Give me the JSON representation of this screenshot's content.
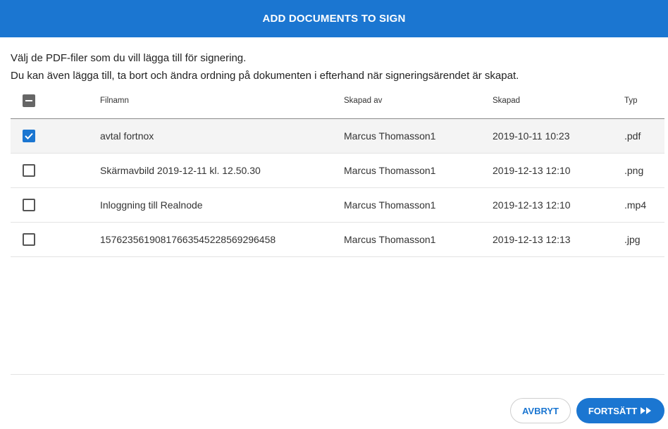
{
  "dialog": {
    "title": "ADD DOCUMENTS TO SIGN",
    "intro_line1": "Välj de PDF-filer som du vill lägga till för signering.",
    "intro_line2": "Du kan även lägga till, ta bort och ändra ordning på dokumenten i efterhand när signeringsärendet är skapat."
  },
  "table": {
    "columns": {
      "name": "Filnamn",
      "created_by": "Skapad av",
      "created": "Skapad",
      "type": "Typ"
    },
    "select_all_state": "indeterminate",
    "rows": [
      {
        "name": "avtal fortnox",
        "created_by": "Marcus Thomasson1",
        "created": "2019-10-11 10:23",
        "type": ".pdf",
        "checked": true
      },
      {
        "name": "Skärmavbild 2019-12-11 kl. 12.50.30",
        "created_by": "Marcus Thomasson1",
        "created": "2019-12-13 12:10",
        "type": ".png",
        "checked": false
      },
      {
        "name": "Inloggning till Realnode",
        "created_by": "Marcus Thomasson1",
        "created": "2019-12-13 12:10",
        "type": ".mp4",
        "checked": false
      },
      {
        "name": "15762356190817663545228569296458",
        "created_by": "Marcus Thomasson1",
        "created": "2019-12-13 12:13",
        "type": ".jpg",
        "checked": false
      }
    ]
  },
  "buttons": {
    "cancel": "AVBRYT",
    "continue": "FORTSÄTT"
  },
  "icons": {
    "continue": "fast-forward-icon",
    "checked": "check-icon",
    "select_all": "minus-icon"
  },
  "colors": {
    "accent": "#1b76d1",
    "selected_row": "#f4f4f4"
  }
}
